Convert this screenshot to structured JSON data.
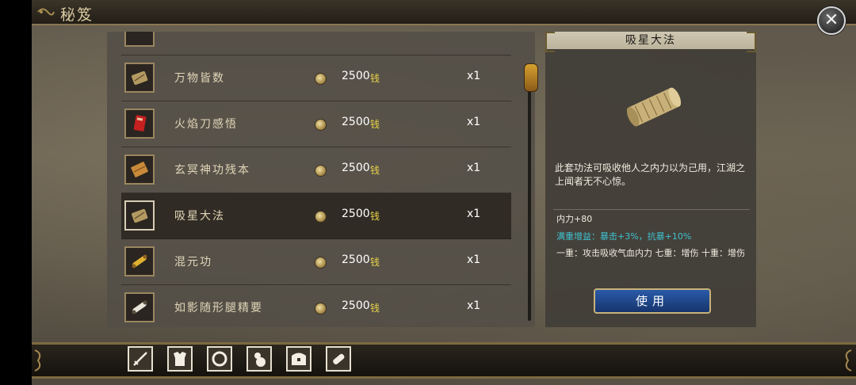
{
  "header": {
    "title": "秘笈"
  },
  "list": {
    "items": [
      {
        "name": "万物皆数",
        "price": "2500",
        "currency": "钱",
        "qty": "x1",
        "icon": "scroll-bundle-icon",
        "selected": false
      },
      {
        "name": "火焰刀感悟",
        "price": "2500",
        "currency": "钱",
        "qty": "x1",
        "icon": "red-book-icon",
        "selected": false
      },
      {
        "name": "玄冥神功残本",
        "price": "2500",
        "currency": "钱",
        "qty": "x1",
        "icon": "brown-book-icon",
        "selected": false
      },
      {
        "name": "吸星大法",
        "price": "2500",
        "currency": "钱",
        "qty": "x1",
        "icon": "scroll-bundle-icon",
        "selected": true
      },
      {
        "name": "混元功",
        "price": "2500",
        "currency": "钱",
        "qty": "x1",
        "icon": "gold-scroll-icon",
        "selected": false
      },
      {
        "name": "如影随形腿精要",
        "price": "2500",
        "currency": "钱",
        "qty": "x1",
        "icon": "white-scroll-icon",
        "selected": false
      }
    ]
  },
  "detail": {
    "title": "吸星大法",
    "description": "此套功法可吸收他人之内力以为己用，江湖之上闻者无不心惊。",
    "stat_primary": "内力+80",
    "stat_bonus": "满重增益：暴击+3%，抗暴+10%",
    "stat_levels": "一重：攻击吸收气血内力 七重：增伤 十重：增伤",
    "use_label": "使用"
  },
  "bottom_tabs": [
    {
      "icon": "sword-icon"
    },
    {
      "icon": "armor-icon"
    },
    {
      "icon": "ring-icon"
    },
    {
      "icon": "gourd-icon"
    },
    {
      "icon": "chest-icon"
    },
    {
      "icon": "scroll-icon"
    }
  ],
  "colors": {
    "accent_gold": "#e8d24a",
    "bonus_cyan": "#3ec2d0",
    "button_blue": "#2a5aa8"
  }
}
